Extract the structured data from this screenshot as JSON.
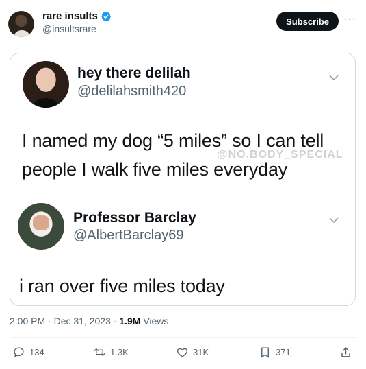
{
  "header": {
    "display_name": "rare insults",
    "handle": "@insultsrare",
    "subscribe_label": "Subscribe",
    "more_label": "···"
  },
  "posts": [
    {
      "name": "hey there delilah",
      "handle": "@delilahsmith420",
      "text_line1": "I named my dog “5 miles” so I can tell",
      "text_line2": "people I walk five miles everyday",
      "watermark": "@NO.BODY_SPECIAL"
    },
    {
      "name": "Professor Barclay",
      "handle": "@AlbertBarclay69",
      "text_line1": "i ran over five miles today"
    }
  ],
  "meta": {
    "time_date": "2:00 PM · Dec 31, 2023 · ",
    "views_count": "1.9M",
    "views_label": " Views"
  },
  "actions": {
    "replies": "134",
    "reposts": "1.3K",
    "likes": "31K",
    "bookmarks": "371"
  },
  "colors": {
    "text": "#0f1419",
    "secondary": "#536471",
    "verified": "#1d9bf0",
    "border": "#cfd9de"
  },
  "icons": [
    "verified-badge-icon",
    "more-icon",
    "chevron-down-icon",
    "reply-icon",
    "repost-icon",
    "like-icon",
    "bookmark-icon",
    "share-icon"
  ]
}
